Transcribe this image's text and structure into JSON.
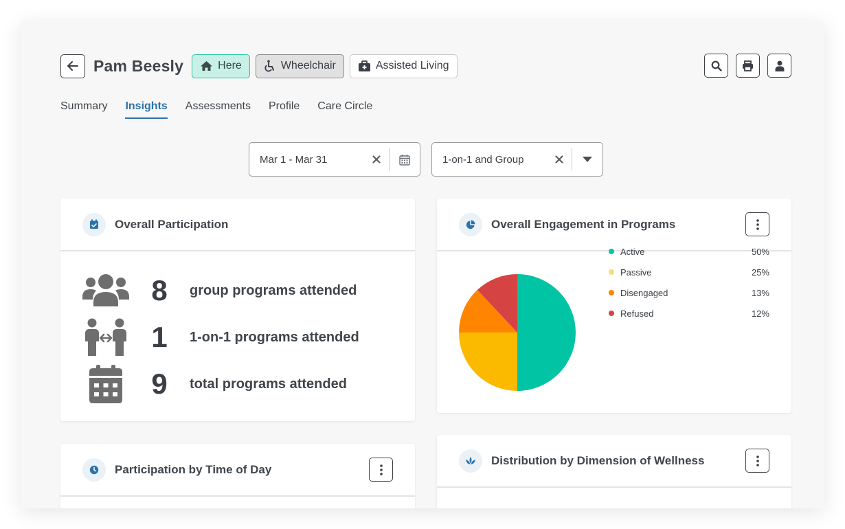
{
  "header": {
    "name": "Pam Beesly",
    "tags": {
      "here": "Here",
      "wheelchair": "Wheelchair",
      "living": "Assisted Living"
    }
  },
  "tabs": [
    "Summary",
    "Insights",
    "Assessments",
    "Profile",
    "Care Circle"
  ],
  "filters": {
    "date_range": "Mar 1 - Mar 31",
    "session_type": "1-on-1 and Group"
  },
  "participation": {
    "title": "Overall Participation",
    "stats": [
      {
        "value": "8",
        "label": "group programs attended",
        "icon": "group-icon"
      },
      {
        "value": "1",
        "label": "1-on-1 programs attended",
        "icon": "one-on-one-icon"
      },
      {
        "value": "9",
        "label": "total programs attended",
        "icon": "calendar-icon"
      }
    ]
  },
  "engagement": {
    "title": "Overall Engagement in Programs",
    "chart_data": {
      "type": "pie",
      "labels": [
        "Active",
        "Passive",
        "Disengaged",
        "Refused"
      ],
      "values": [
        50,
        25,
        13,
        12
      ],
      "value_labels": [
        "50%",
        "25%",
        "13%",
        "12%"
      ],
      "colors": [
        "#00c4a3",
        "#fbb900",
        "#ff8500",
        "#d64343"
      ],
      "legend_colors": [
        "#00c4a3",
        "#f5dc7c",
        "#ff8500",
        "#d64343"
      ],
      "legend_position": "right"
    }
  },
  "time_of_day": {
    "title": "Participation by Time of Day"
  },
  "wellness": {
    "title": "Distribution by Dimension of Wellness"
  }
}
